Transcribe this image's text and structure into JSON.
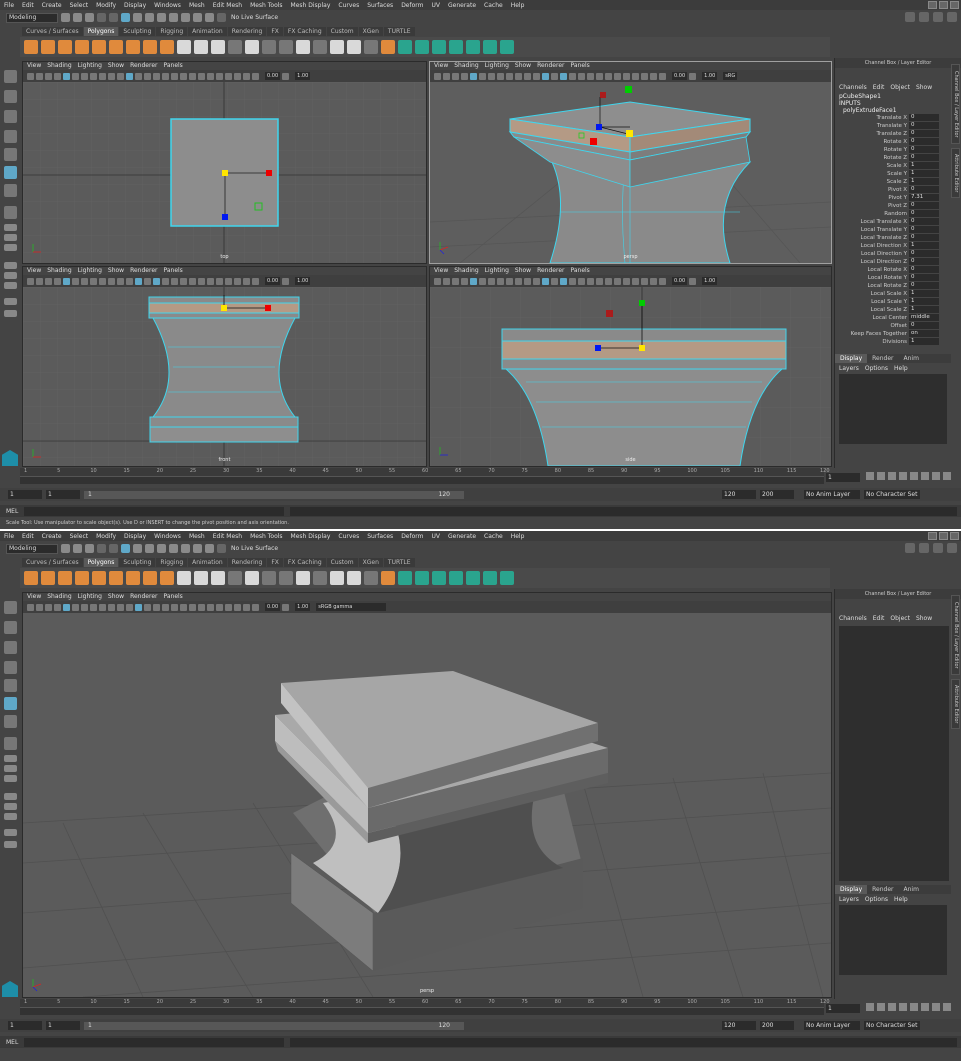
{
  "menu": [
    "File",
    "Edit",
    "Create",
    "Select",
    "Modify",
    "Display",
    "Windows",
    "Mesh",
    "Edit Mesh",
    "Mesh Tools",
    "Mesh Display",
    "Curves",
    "Surfaces",
    "Deform",
    "UV",
    "Generate",
    "Cache",
    "Help"
  ],
  "mode": "Modeling",
  "live_surface": "No Live Surface",
  "shelf_tabs": [
    "Curves / Surfaces",
    "Polygons",
    "Sculpting",
    "Rigging",
    "Animation",
    "Rendering",
    "FX",
    "FX Caching",
    "Custom",
    "XGen",
    "TURTLE"
  ],
  "vp_menu": [
    "View",
    "Shading",
    "Lighting",
    "Show",
    "Renderer",
    "Panels"
  ],
  "vp_nums": {
    "a": "0.00",
    "b": "1.00",
    "cs_short": "sRG",
    "cs_full": "sRGB gamma"
  },
  "vp_labels": {
    "top": "top",
    "persp": "persp",
    "front": "front",
    "side": "side"
  },
  "channel": {
    "title": "Channel Box / Layer Editor",
    "menu": [
      "Channels",
      "Edit",
      "Object",
      "Show"
    ],
    "object": "pCubeShape1",
    "inputs": "INPUTS",
    "node": "polyExtrudeFace1",
    "rows": [
      {
        "k": "Translate X",
        "v": "0"
      },
      {
        "k": "Translate Y",
        "v": "0"
      },
      {
        "k": "Translate Z",
        "v": "0"
      },
      {
        "k": "Rotate X",
        "v": "0"
      },
      {
        "k": "Rotate Y",
        "v": "0"
      },
      {
        "k": "Rotate Z",
        "v": "0"
      },
      {
        "k": "Scale X",
        "v": "1"
      },
      {
        "k": "Scale Y",
        "v": "1"
      },
      {
        "k": "Scale Z",
        "v": "1"
      },
      {
        "k": "Pivot X",
        "v": "0"
      },
      {
        "k": "Pivot Y",
        "v": "7.31"
      },
      {
        "k": "Pivot Z",
        "v": "0"
      },
      {
        "k": "Random",
        "v": "0"
      },
      {
        "k": "Local Translate X",
        "v": "0"
      },
      {
        "k": "Local Translate Y",
        "v": "0"
      },
      {
        "k": "Local Translate Z",
        "v": "0"
      },
      {
        "k": "Local Direction X",
        "v": "1"
      },
      {
        "k": "Local Direction Y",
        "v": "0"
      },
      {
        "k": "Local Direction Z",
        "v": "0"
      },
      {
        "k": "Local Rotate X",
        "v": "0"
      },
      {
        "k": "Local Rotate Y",
        "v": "0"
      },
      {
        "k": "Local Rotate Z",
        "v": "0"
      },
      {
        "k": "Local Scale X",
        "v": "1"
      },
      {
        "k": "Local Scale Y",
        "v": "1"
      },
      {
        "k": "Local Scale Z",
        "v": "1"
      },
      {
        "k": "Local Center",
        "v": "middle"
      },
      {
        "k": "Offset",
        "v": "0"
      },
      {
        "k": "Keep Faces Together",
        "v": "on"
      },
      {
        "k": "Divisions",
        "v": "1"
      }
    ]
  },
  "layer": {
    "tabs": [
      "Display",
      "Render",
      "Anim"
    ],
    "menu": [
      "Layers",
      "Options",
      "Help"
    ]
  },
  "side_tabs": {
    "a": "Channel Box / Layer Editor",
    "b": "Attribute Editor"
  },
  "timeline": {
    "ticks": [
      "1",
      "5",
      "10",
      "15",
      "20",
      "25",
      "30",
      "35",
      "40",
      "45",
      "50",
      "55",
      "60",
      "65",
      "70",
      "75",
      "80",
      "85",
      "90",
      "95",
      "100",
      "105",
      "110",
      "115",
      "120"
    ],
    "current": "1"
  },
  "range": {
    "start": "1",
    "start2": "1",
    "slider_start": "1",
    "slider_end": "120",
    "end": "120",
    "end2": "200",
    "anim_layer": "No Anim Layer",
    "char_set": "No Character Set"
  },
  "mel": "MEL",
  "help": "Scale Tool: Use manipulator to scale object(s). Use D or INSERT to change the pivot position and axis orientation."
}
